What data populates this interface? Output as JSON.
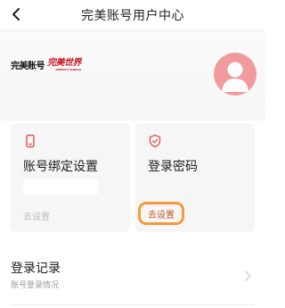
{
  "header": {
    "title": "完美账号用户中心",
    "back_icon": "chevron-left-icon"
  },
  "brand": {
    "logo_text": "完美账号",
    "world_logo_text": "完美世界",
    "world_logo_subtext": "PERFECT WORLD",
    "world_logo_color": "#c4121f"
  },
  "avatar": {
    "icon": "user-avatar-icon",
    "color": "#f29b9d"
  },
  "cards": {
    "binding": {
      "icon": "phone-icon",
      "title": "账号绑定设置",
      "action": "去设置"
    },
    "password": {
      "icon": "shield-check-icon",
      "title": "登录密码",
      "action": "去设置",
      "highlight_color": "#f59a3c"
    }
  },
  "record": {
    "title": "登录记录",
    "subtitle": "账号登录情况",
    "icon": "chevron-right-icon"
  }
}
